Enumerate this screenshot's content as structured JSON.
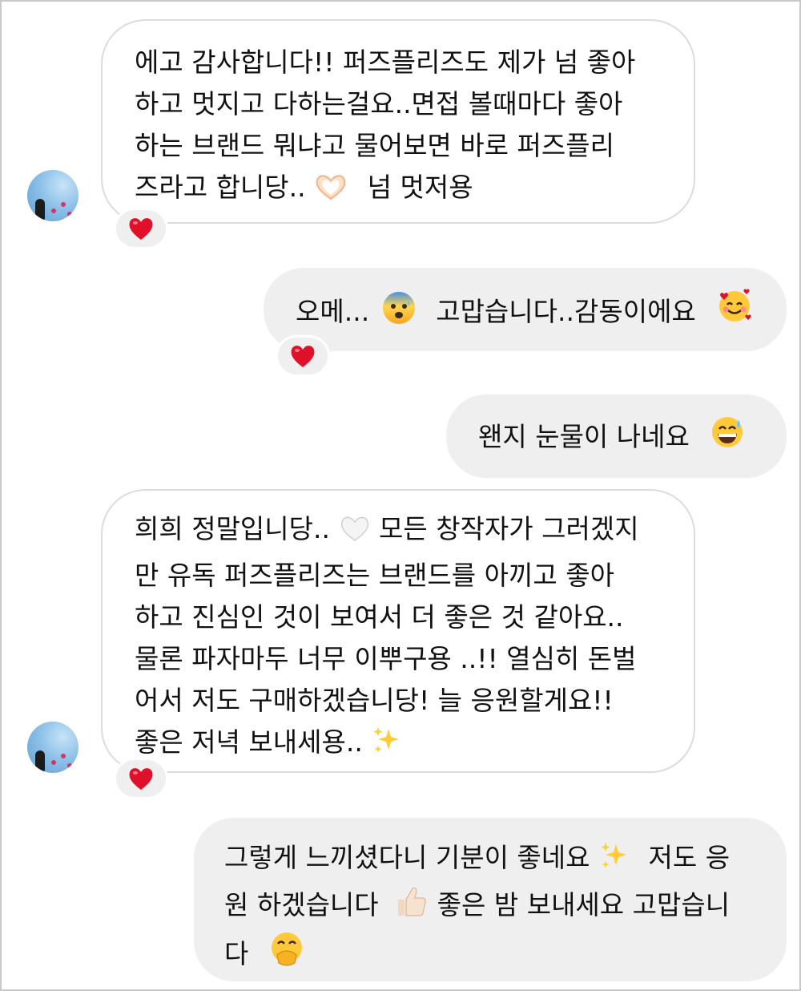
{
  "messages": [
    {
      "sender": "other",
      "lines": [
        "에고 감사합니다!! 퍼즈플리즈도 제가 넘 좋아",
        "하고 멋지고 다하는걸요..면접 볼때마다 좋아",
        "하는 브랜드 뭐냐고 물어보면 바로 퍼즈플리",
        "즈라고 합니당..",
        "넘 멋저용"
      ],
      "emoji": [
        "heart-hands"
      ],
      "reaction": "❤️"
    },
    {
      "sender": "me",
      "parts": [
        "오메...",
        "고맙습니다..감동이에요"
      ],
      "emoji": [
        "anxious-face-with-sweat",
        "smiling-face-with-hearts"
      ],
      "reaction": "❤️"
    },
    {
      "sender": "me",
      "parts": [
        "왠지 눈물이 나네요"
      ],
      "emoji": [
        "grinning-face-with-sweat"
      ]
    },
    {
      "sender": "other",
      "lines": [
        "희희 정말입니당..",
        "모든 창작자가 그러겠지",
        "만 유독 퍼즈플리즈는 브랜드를 아끼고 좋아",
        "하고 진심인 것이 보여서 더 좋은 것 같아요..",
        "물론 파자마두 너무 이뿌구용 ..!! 열심히 돈벌",
        "어서 저도 구매하겠습니당! 늘 응원할게요!!",
        "좋은 저녁 보내세용.."
      ],
      "emoji": [
        "white-heart",
        "sparkles"
      ],
      "reaction": "❤️"
    },
    {
      "sender": "me",
      "lines": [
        "그렇게 느끼셨다니 기분이 좋네요",
        "저도 응",
        "원 하겠습니다",
        "좋은 밤 보내세요 고맙습니",
        "다"
      ],
      "emoji": [
        "sparkles",
        "thumbs-up",
        "face-with-hand-over-mouth"
      ]
    }
  ],
  "colors": {
    "outgoing_bubble": "#efefef",
    "incoming_bubble_border": "#dcdcdc",
    "reaction_heart": "#e0102a",
    "text": "#111111"
  }
}
